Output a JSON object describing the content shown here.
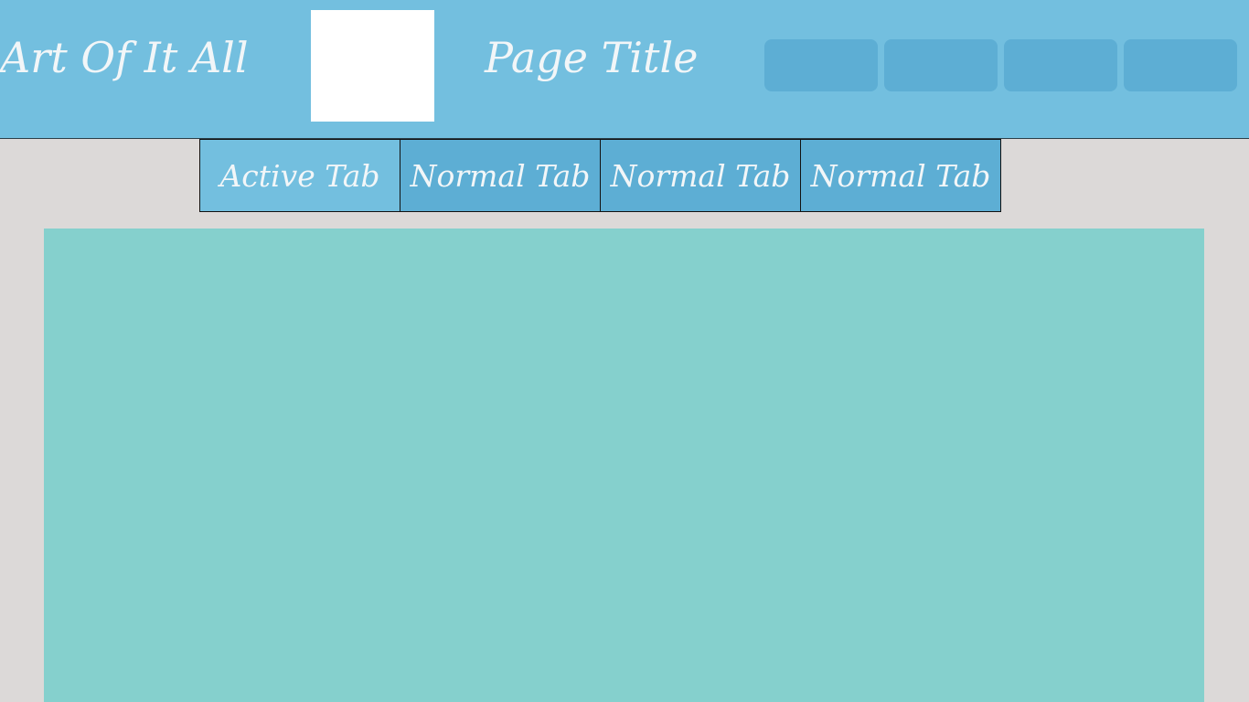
{
  "header": {
    "site_title": "Art Of It All",
    "page_title": "Page Title",
    "nav_buttons": [
      "",
      "",
      "",
      ""
    ]
  },
  "tabs": [
    {
      "label": "Active Tab",
      "active": true
    },
    {
      "label": "Normal Tab",
      "active": false
    },
    {
      "label": "Normal Tab",
      "active": false
    },
    {
      "label": "Normal Tab",
      "active": false
    }
  ],
  "colors": {
    "header_bg": "#73bfdf",
    "button_bg": "#5daed4",
    "page_bg": "#dcd9d8",
    "content_bg": "#85d0cd",
    "text": "#f2f6f8"
  }
}
